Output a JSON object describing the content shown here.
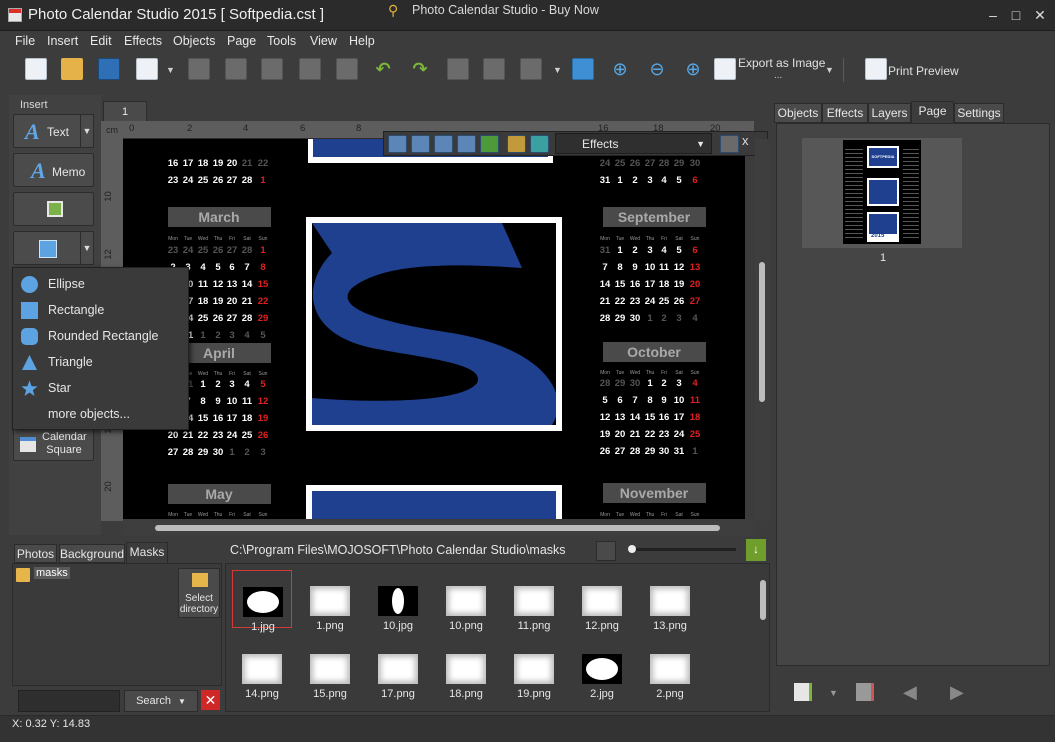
{
  "window": {
    "title": "Photo Calendar Studio 2015 [ Softpedia.cst ]",
    "min": "–",
    "max": "□",
    "close": "✕"
  },
  "menu": {
    "items": [
      "File",
      "Insert",
      "Edit",
      "Effects",
      "Objects",
      "Page",
      "Tools",
      "View",
      "Help"
    ],
    "buy_now": "Photo Calendar Studio - Buy Now"
  },
  "toolbar": {
    "export_label": "Export as Image",
    "export_dots": "...",
    "print_preview_label": "Print Preview"
  },
  "insert_panel": {
    "label": "Insert",
    "text_button": "Text",
    "memo_button": "Memo",
    "calendar_button_line1": "Calendar",
    "calendar_button_line2": "Square"
  },
  "shape_menu": {
    "items": [
      "Ellipse",
      "Rectangle",
      "Rounded Rectangle",
      "Triangle",
      "Star",
      "more objects..."
    ]
  },
  "canvas": {
    "page_tab": "1",
    "ruler_unit": "cm",
    "ruler_top_labels": [
      "0",
      "2",
      "4",
      "6",
      "8",
      "10",
      "12",
      "14",
      "16",
      "18",
      "20"
    ],
    "ruler_left_labels": [
      "10",
      "12",
      "14",
      "16",
      "18",
      "20"
    ],
    "effects_select": "Effects",
    "effects_close": "x"
  },
  "calendar": {
    "left_months": [
      {
        "name": "March",
        "rows": [
          [
            "23",
            "24",
            "25",
            "26",
            "27",
            "28",
            "1"
          ],
          [
            "2",
            "3",
            "4",
            "5",
            "6",
            "7",
            "8"
          ],
          [
            "9",
            "10",
            "11",
            "12",
            "13",
            "14",
            "15"
          ],
          [
            "16",
            "17",
            "18",
            "19",
            "20",
            "21",
            "22"
          ],
          [
            "23",
            "24",
            "25",
            "26",
            "27",
            "28",
            "29"
          ],
          [
            "30",
            "31",
            "1",
            "2",
            "3",
            "4",
            "5"
          ]
        ]
      },
      {
        "name": "April",
        "rows": [
          [
            "30",
            "31",
            "1",
            "2",
            "3",
            "4",
            "5"
          ],
          [
            "6",
            "7",
            "8",
            "9",
            "10",
            "11",
            "12"
          ],
          [
            "13",
            "14",
            "15",
            "16",
            "17",
            "18",
            "19"
          ],
          [
            "20",
            "21",
            "22",
            "23",
            "24",
            "25",
            "26"
          ],
          [
            "27",
            "28",
            "29",
            "30",
            "1",
            "2",
            "3"
          ]
        ]
      },
      {
        "name": "May",
        "rows": []
      }
    ],
    "right_months": [
      {
        "name": "September",
        "rows": [
          [
            "31",
            "1",
            "2",
            "3",
            "4",
            "5",
            "6"
          ],
          [
            "7",
            "8",
            "9",
            "10",
            "11",
            "12",
            "13"
          ],
          [
            "14",
            "15",
            "16",
            "17",
            "18",
            "19",
            "20"
          ],
          [
            "21",
            "22",
            "23",
            "24",
            "25",
            "26",
            "27"
          ],
          [
            "28",
            "29",
            "30",
            "1",
            "2",
            "3",
            "4"
          ]
        ]
      },
      {
        "name": "October",
        "rows": [
          [
            "28",
            "29",
            "30",
            "1",
            "2",
            "3",
            "4"
          ],
          [
            "5",
            "6",
            "7",
            "8",
            "9",
            "10",
            "11"
          ],
          [
            "12",
            "13",
            "14",
            "15",
            "16",
            "17",
            "18"
          ],
          [
            "19",
            "20",
            "21",
            "22",
            "23",
            "24",
            "25"
          ],
          [
            "26",
            "27",
            "28",
            "29",
            "30",
            "31",
            "1"
          ]
        ]
      },
      {
        "name": "November",
        "rows": []
      }
    ],
    "top_left_rows": [
      [
        "16",
        "17",
        "18",
        "19",
        "20",
        "21",
        "22"
      ],
      [
        "23",
        "24",
        "25",
        "26",
        "27",
        "28",
        "1"
      ]
    ],
    "top_right_rows": [
      [
        "24",
        "25",
        "26",
        "27",
        "28",
        "29",
        "30"
      ],
      [
        "31",
        "1",
        "2",
        "3",
        "4",
        "5",
        "6"
      ]
    ],
    "weekday_header": [
      "Mon",
      "Tue",
      "Wed",
      "Thu",
      "Fri",
      "Sat",
      "Sun"
    ]
  },
  "right_panel": {
    "tabs": [
      "Objects",
      "Effects",
      "Layers",
      "Page",
      "Settings"
    ],
    "active_tab": "Page",
    "page_number": "1",
    "thumb_text": "SOFTPEDIA",
    "thumb_year": "2015"
  },
  "bottom_left": {
    "tabs": [
      "Photos",
      "Background",
      "Masks"
    ],
    "active_tab": "Masks",
    "folder": "masks",
    "select_dir_line1": "Select",
    "select_dir_line2": "directory",
    "search_label": "Search",
    "search_value": ""
  },
  "gallery": {
    "path": "C:\\Program Files\\MOJOSOFT\\Photo Calendar Studio\\masks",
    "items": [
      "1.jpg",
      "1.png",
      "10.jpg",
      "10.png",
      "11.png",
      "12.png",
      "13.png",
      "14.png",
      "15.png",
      "17.png",
      "18.png",
      "19.png",
      "2.jpg",
      "2.png"
    ],
    "selected": "1.jpg"
  },
  "status": {
    "coords": "X: 0.32 Y: 14.83"
  },
  "colors": {
    "accent_blue": "#1f3f8f",
    "weekend_red": "#e02020",
    "bg_dark": "#3c3c3c"
  }
}
